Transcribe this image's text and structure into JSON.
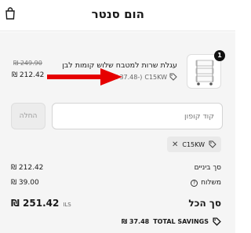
{
  "header": {
    "title": "הום סנטר",
    "cart_icon": "shopping-bag-icon"
  },
  "product": {
    "title": "עגלת שרות למטבח שלוש קומות לבן",
    "quantity": "1",
    "discount_code": "C15KW",
    "discount_amount": "(₪ 37.48-)",
    "original_price": "₪ 249.90",
    "price": "₪ 212.42"
  },
  "coupon": {
    "placeholder": "קוד קופון",
    "apply_label": "החלה"
  },
  "applied_code": {
    "code": "C15KW"
  },
  "summary": {
    "subtotal_label": "סך ביניים",
    "subtotal_value": "₪ 212.42",
    "shipping_label": "משלוח",
    "shipping_value": "₪ 39.00",
    "total_label": "סך הכל",
    "total_currency": "ILS",
    "total_value": "₪ 251.42",
    "savings_label": "TOTAL SAVINGS",
    "savings_value": "₪ 37.48"
  },
  "colors": {
    "annotation_arrow": "#e60000",
    "panel_bg": "#f5f5f5"
  }
}
